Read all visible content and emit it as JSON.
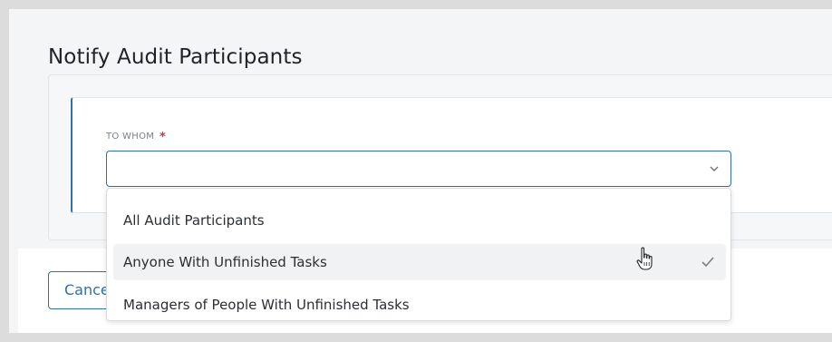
{
  "page": {
    "title": "Notify Audit Participants"
  },
  "form": {
    "field_label": "TO WHOM",
    "required_mark": "*",
    "selected_value": ""
  },
  "dropdown": {
    "options": [
      {
        "label": "All Audit Participants",
        "selected": false
      },
      {
        "label": "Anyone With Unfinished Tasks",
        "selected": true
      },
      {
        "label": "Managers of People With Unfinished Tasks",
        "selected": false
      }
    ]
  },
  "footer": {
    "cancel_label": "Cancel"
  },
  "icons": {
    "select_toggle": "chevron-down-icon",
    "selected_marker": "check-icon",
    "pointer": "hand-cursor-icon"
  },
  "colors": {
    "accent": "#2f6fab",
    "required": "#d0304f",
    "option_hover": "#f1f2f4"
  }
}
